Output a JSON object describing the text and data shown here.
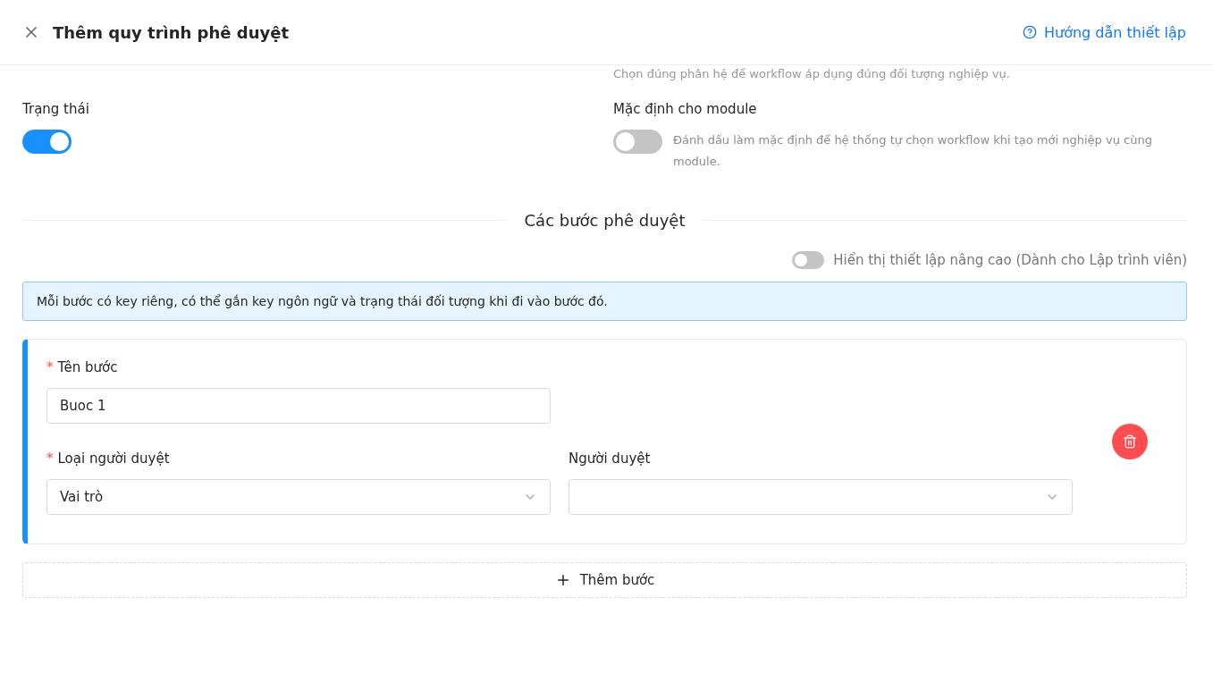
{
  "header": {
    "title": "Thêm quy trình phê duyệt",
    "help_link": "Hướng dẫn thiết lập"
  },
  "module_hint": "Chọn đúng phân hệ để workflow áp dụng đúng đối tượng nghiệp vụ.",
  "status": {
    "label": "Trạng thái",
    "on": true
  },
  "default_module": {
    "label": "Mặc định cho module",
    "on": false,
    "description": "Đánh dấu làm mặc định để hệ thống tự chọn workflow khi tạo mới nghiệp vụ cùng module."
  },
  "section_title": "Các bước phê duyệt",
  "advanced": {
    "label": "Hiển thị thiết lập nâng cao (Dành cho Lập trình viên)",
    "on": false
  },
  "info": "Mỗi bước có key riêng, có thể gắn key ngôn ngữ và trạng thái đối tượng khi đi vào bước đó.",
  "steps": [
    {
      "name_label": "Tên bước",
      "name_mark": "*",
      "name_value": "Buoc 1",
      "type_label": "Loại người duyệt",
      "type_mark": "*",
      "type_value": "Vai trò",
      "approver_label": "Người duyệt"
    }
  ],
  "add_step": "Thêm bước"
}
